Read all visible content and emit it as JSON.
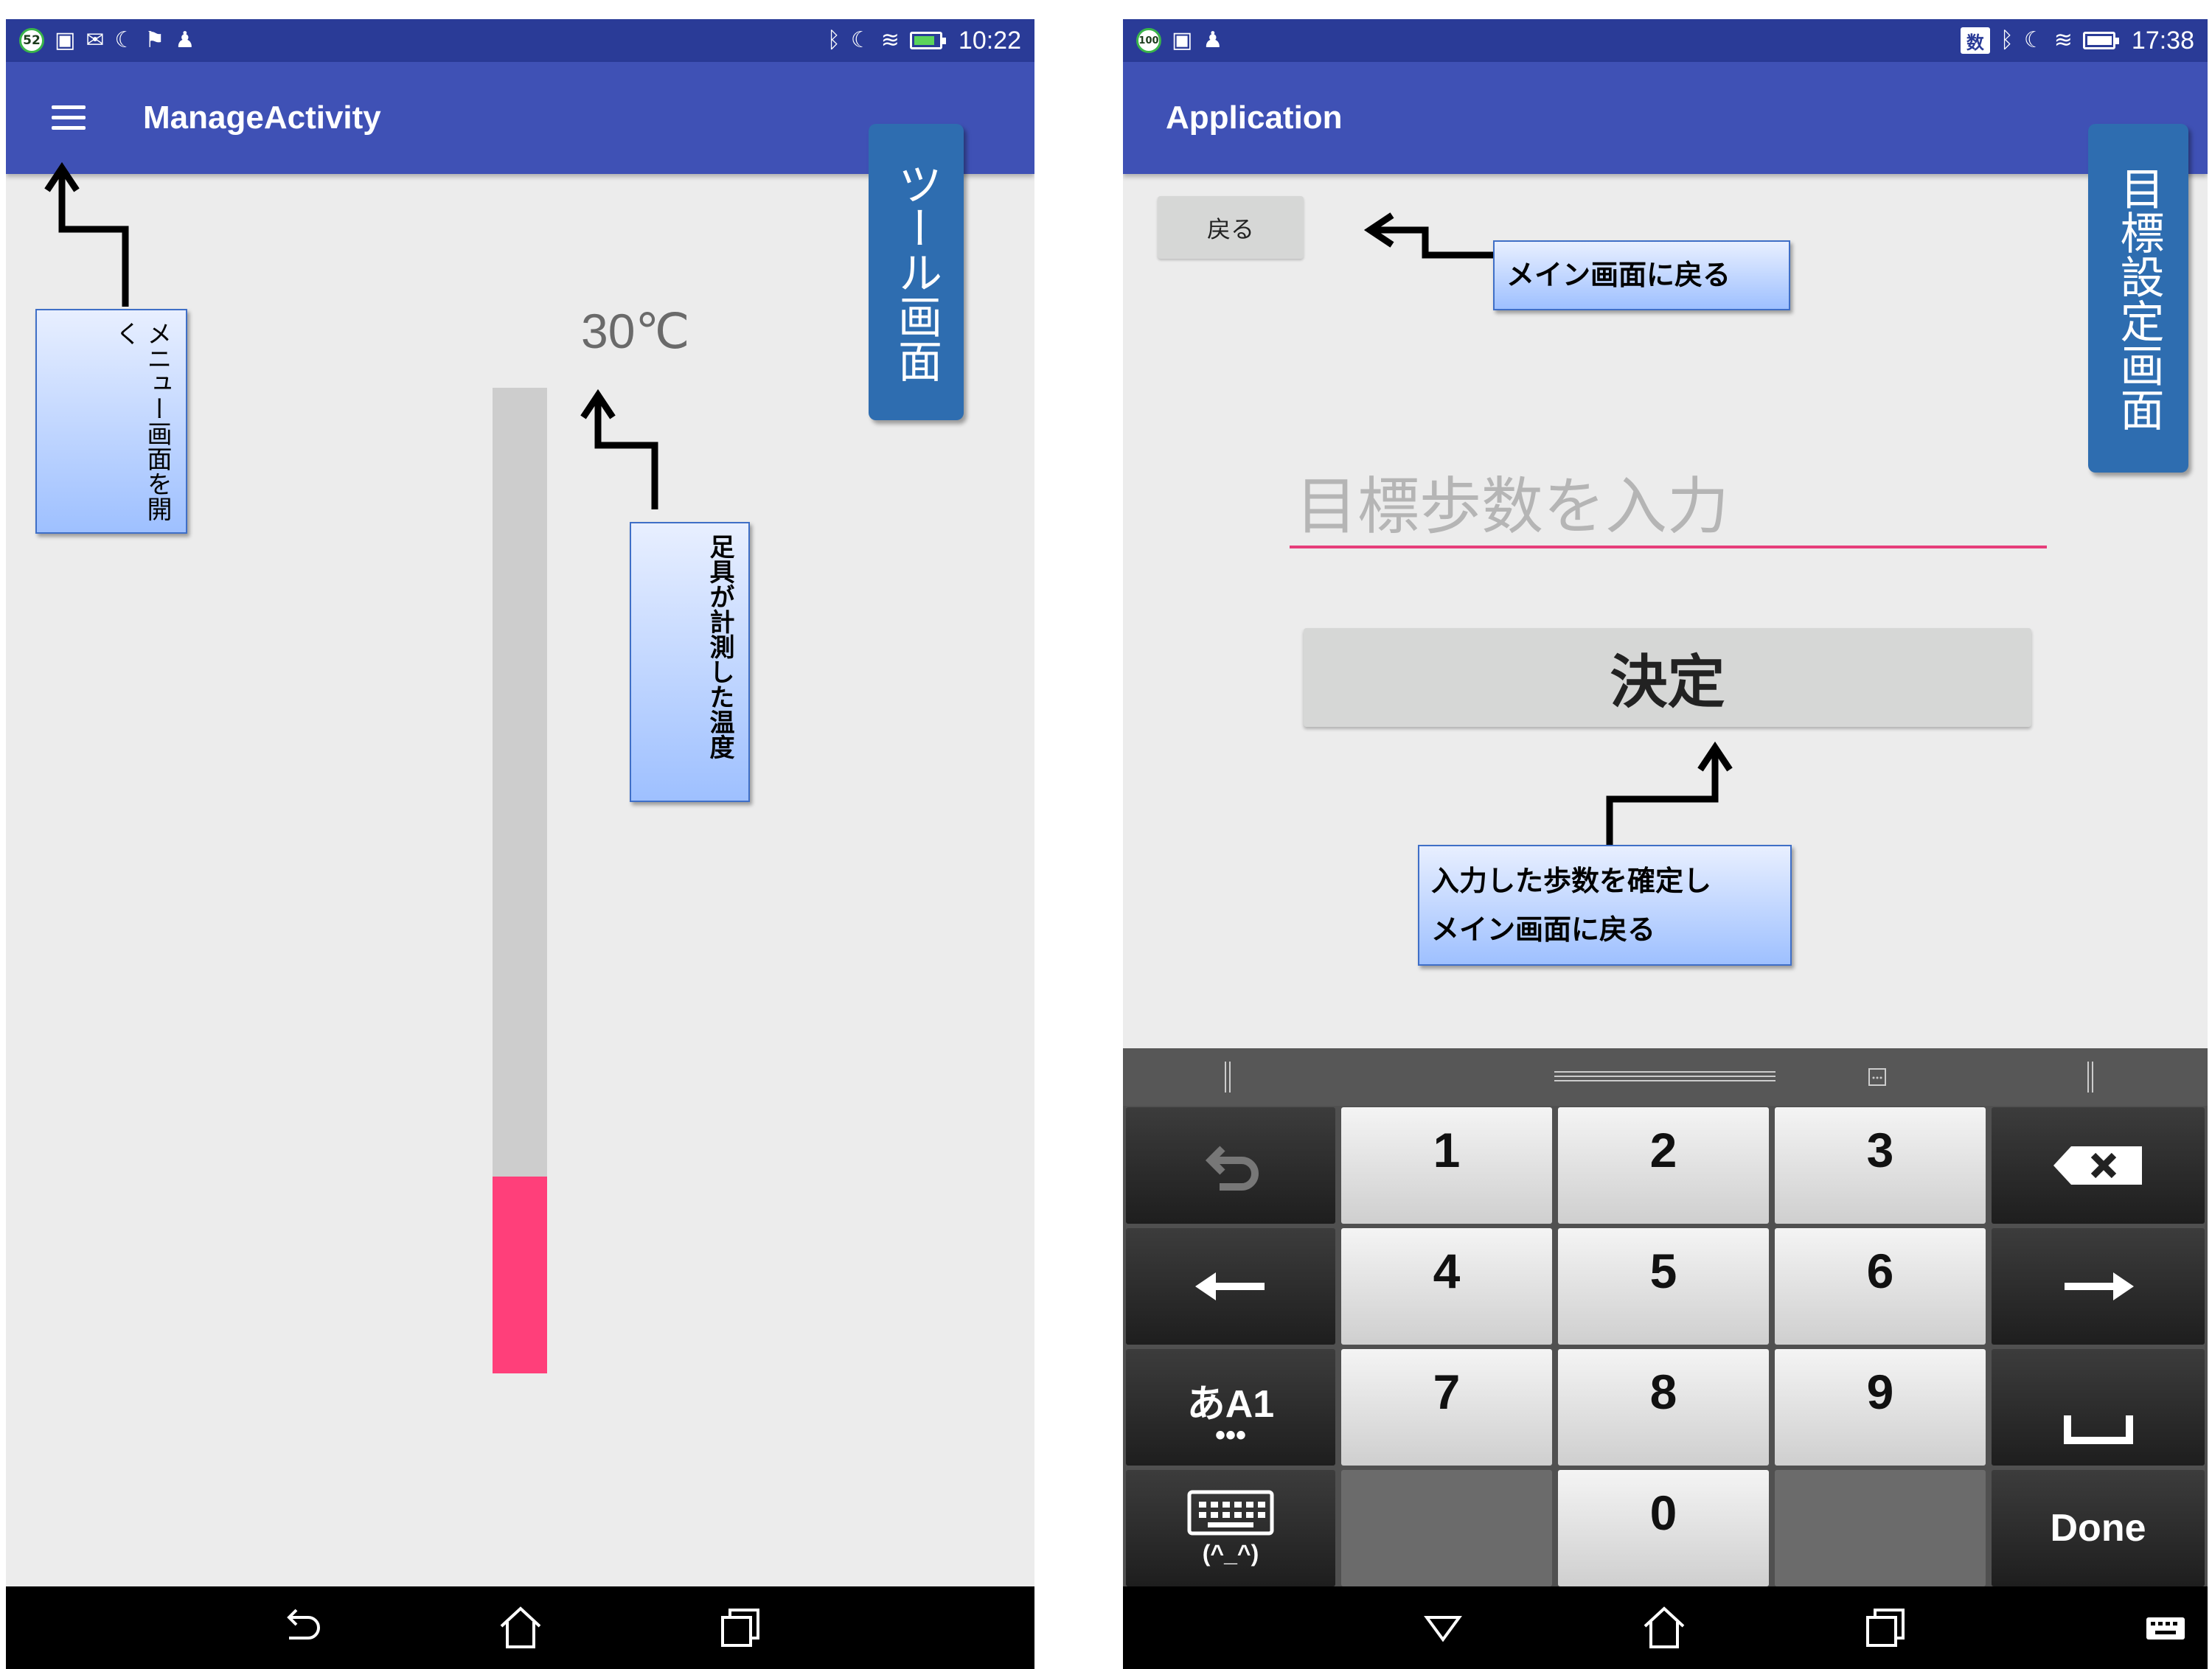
{
  "left_screen": {
    "status": {
      "notification_badge": "52",
      "left_icons": [
        "image-icon",
        "mail-icon",
        "moon-icon",
        "flag-icon",
        "android-icon"
      ],
      "right_icons": [
        "bluetooth-icon",
        "moon-icon",
        "wifi-icon",
        "battery-charging-icon"
      ],
      "time": "10:22"
    },
    "appbar": {
      "title": "ManageActivity",
      "menu_icon": "hamburger-icon"
    },
    "screen_label": "ツール画面",
    "temperature": {
      "text": "30℃",
      "level": 0.2,
      "bar_color": "#ff3f7a",
      "track_color": "#cdcdcd"
    },
    "callouts": {
      "menu": "メニュー画面を開く",
      "temperature": "足具が計測した温度"
    },
    "navbar": {
      "buttons": [
        "back-icon",
        "home-icon",
        "recents-icon"
      ]
    }
  },
  "right_screen": {
    "status": {
      "notification_badge": "100",
      "left_icons": [
        "image-icon",
        "android-icon"
      ],
      "keyboard_indicator": "数",
      "right_icons": [
        "bluetooth-icon",
        "moon-icon",
        "wifi-icon",
        "battery-icon"
      ],
      "time": "17:38"
    },
    "appbar": {
      "title": "Application"
    },
    "screen_label": "目標設定画面",
    "back_button": "戻る",
    "input_placeholder": "目標歩数を入力",
    "confirm_button": "決定",
    "callouts": {
      "back": "メイン画面に戻る",
      "confirm_line1": "入力した歩数を確定し",
      "confirm_line2": "メイン画面に戻る"
    },
    "keyboard": {
      "row1": [
        "undo-icon",
        "1",
        "2",
        "3",
        "backspace-icon"
      ],
      "row2": [
        "left-arrow-icon",
        "4",
        "5",
        "6",
        "right-arrow-icon"
      ],
      "row3": [
        "あA1",
        "7",
        "8",
        "9",
        "space-icon"
      ],
      "row4": [
        "keyboard-emoji-icon",
        "",
        "0",
        "",
        "Done"
      ],
      "emoticon": "(^_^)"
    },
    "navbar": {
      "buttons": [
        "back-triangle-icon",
        "home-icon",
        "recents-icon",
        "keyboard-icon"
      ]
    }
  },
  "colors": {
    "appbar": "#3f51b5",
    "statusbar": "#2a3b97",
    "accent": "#e63e7a",
    "label_blue": "#2e6db0"
  }
}
